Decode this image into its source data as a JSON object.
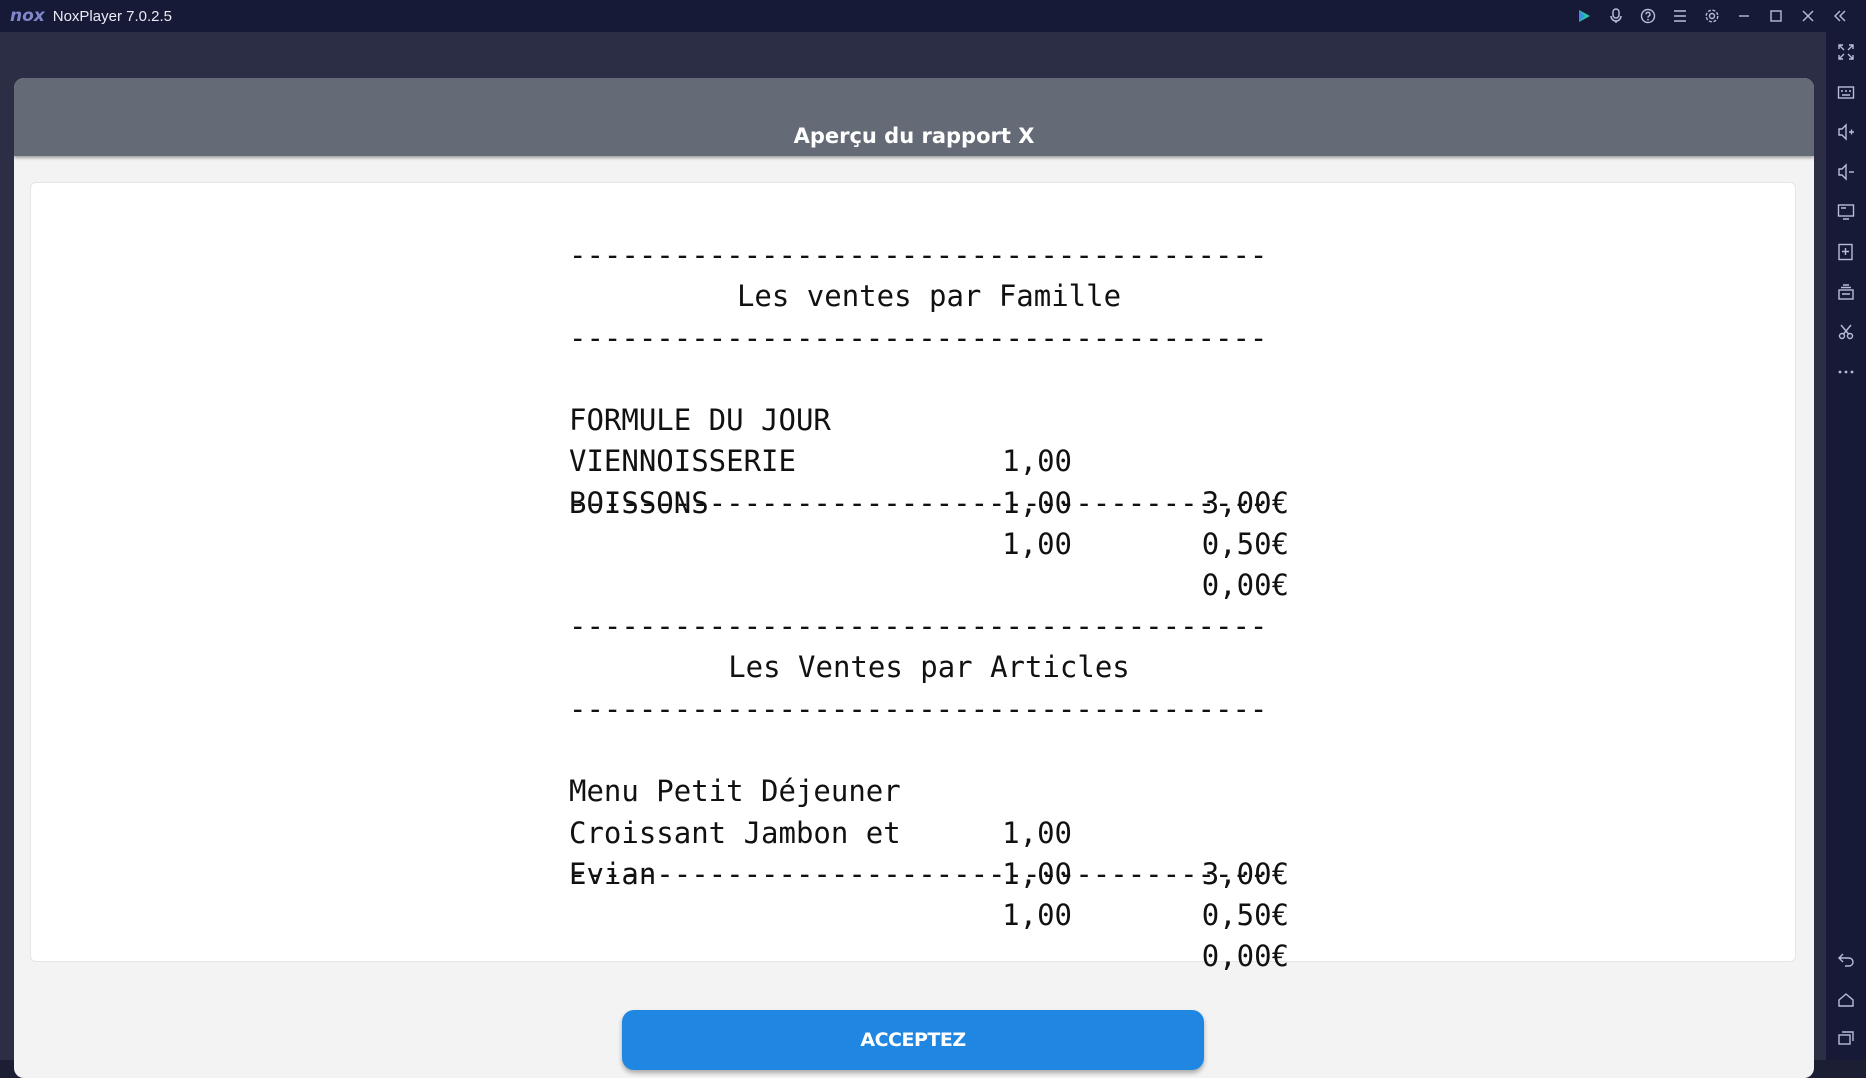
{
  "window": {
    "logo": "nox",
    "title": "NoxPlayer 7.0.2.5",
    "controls": [
      "play-icon",
      "microphone-icon",
      "help-icon",
      "menu-icon",
      "settings-icon",
      "minimize-icon",
      "maximize-icon",
      "close-icon",
      "collapse-sidebar-icon"
    ]
  },
  "sidebar": {
    "tools": [
      "fullscreen-icon",
      "keyboard-icon",
      "volume-up-icon",
      "volume-down-icon",
      "screen-icon",
      "add-apk-icon",
      "multi-instance-icon",
      "screenshot-icon",
      "more-icon"
    ],
    "nav": [
      "back-icon",
      "home-icon",
      "recent-apps-icon"
    ]
  },
  "app": {
    "header_title": "Aperçu du rapport X",
    "accept_label": "ACCEPTEZ"
  },
  "report": {
    "separator": "----------------------------------------",
    "section1": {
      "title": "Les ventes par Famille",
      "rows": [
        {
          "name": "FORMULE DU JOUR",
          "qty": "1,00",
          "amount": "3,00€"
        },
        {
          "name": "VIENNOISSERIE",
          "qty": "1,00",
          "amount": "0,50€"
        },
        {
          "name": "BOISSONS",
          "qty": "1,00",
          "amount": "0,00€"
        }
      ]
    },
    "section2": {
      "title": "Les Ventes par Articles",
      "rows": [
        {
          "name": "Menu Petit Déjeuner",
          "qty": "1,00",
          "amount": "3,00€"
        },
        {
          "name": "Croissant Jambon et",
          "qty": "1,00",
          "amount": "0,50€"
        },
        {
          "name": "Evian",
          "qty": "1,00",
          "amount": "0,00€"
        }
      ]
    }
  },
  "colors": {
    "titlebar": "#161a36",
    "header": "#646a76",
    "accent": "#1f86e2"
  }
}
